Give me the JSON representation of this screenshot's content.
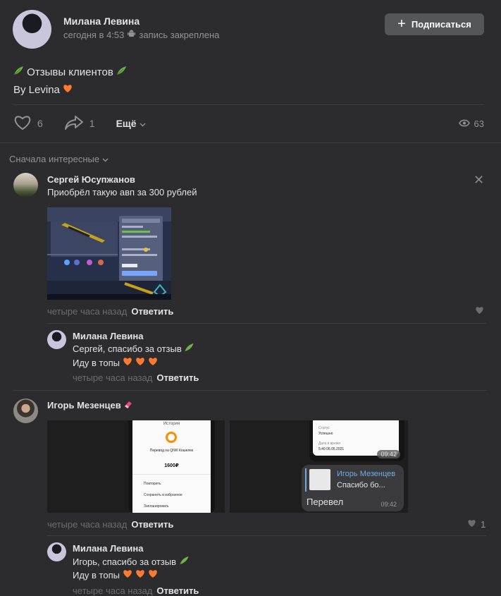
{
  "post": {
    "author": "Милана Левина",
    "time": "сегодня в 4:53",
    "pinned": "запись закреплена",
    "subscribe_label": "Подписаться",
    "text_line1": "Отзывы клиентов",
    "text_line2": "By Levina",
    "likes": "6",
    "shares": "1",
    "more_label": "Ещё",
    "views": "63"
  },
  "sort_label": "Сначала интересные",
  "comments": [
    {
      "author": "Сергей Юсупжанов",
      "text": "Приобрёл такую авп за 300 рублей",
      "time": "четыре часа назад",
      "reply_label": "Ответить",
      "reply": {
        "author": "Милана Левина",
        "line1": "Сергей, спасибо за отзыв",
        "line2": "Иду в топы",
        "time": "четыре часа назад",
        "reply_label": "Ответить"
      }
    },
    {
      "author": "Игорь Мезенцев",
      "time": "четыре часа назад",
      "reply_label": "Ответить",
      "likes": "1",
      "screens": {
        "header": "История",
        "transfer": "Перевод на QIWI Кошелек",
        "amount": "1600₽",
        "menu": [
          "Повторить",
          "Сохранить в избранное",
          "Запланировать"
        ],
        "status_label": "Статус",
        "status": "Успешно",
        "date_label": "Дата и время",
        "date": "5:40 06.05.2021",
        "time1": "09:42",
        "chat_name": "Игорь Мезенцев",
        "chat_text": "Спасибо бо...",
        "chat_msg": "Перевел",
        "time2": "09:42"
      },
      "reply": {
        "author": "Милана Левина",
        "line1": "Игорь, спасибо за отзыв",
        "line2": "Иду в топы",
        "time": "четыре часа назад",
        "reply_label": "Ответить"
      }
    }
  ],
  "colors": {
    "background": "#2c2c2e",
    "text": "#e1e3e6",
    "muted": "#939393",
    "heart": "#ff7a2e",
    "leaf": "#6fb34a",
    "link": "#71aaeb"
  }
}
